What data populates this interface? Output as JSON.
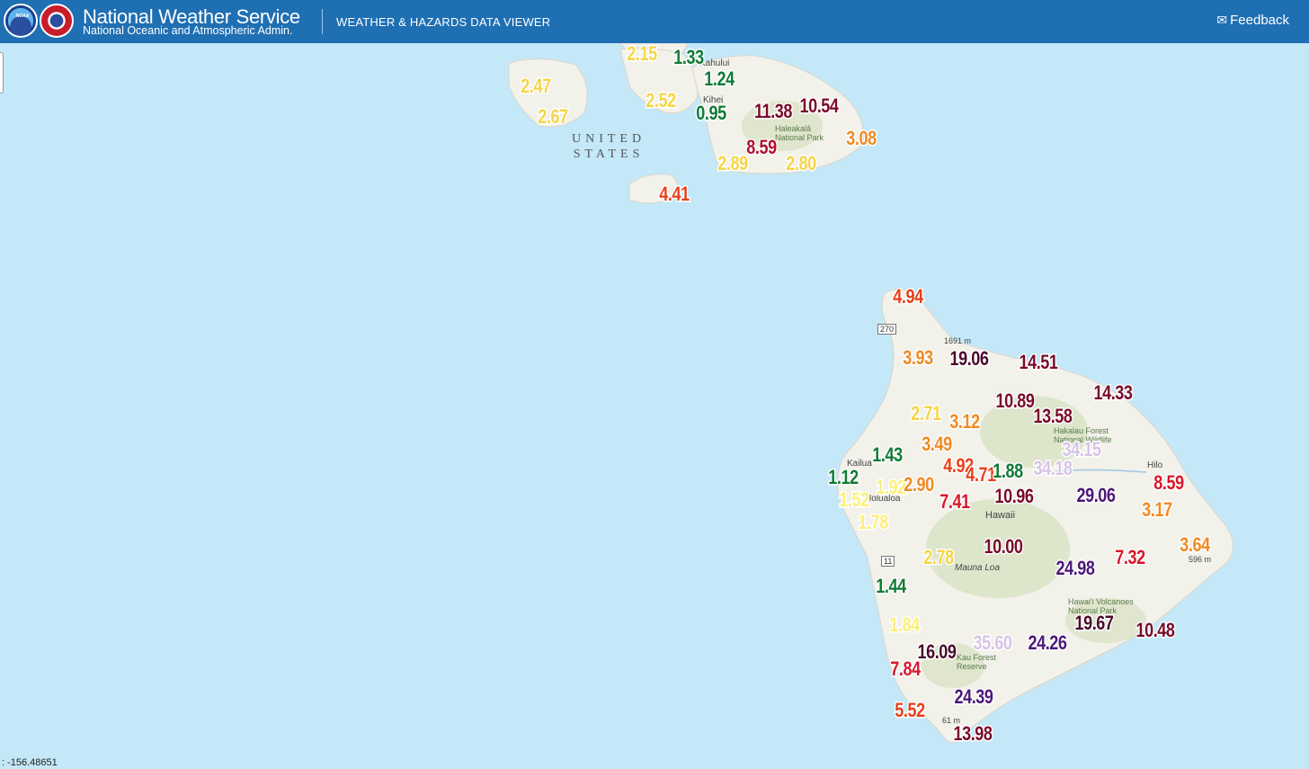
{
  "header": {
    "title": "National Weather Service",
    "subtitle": "National Oceanic and Atmospheric Admin.",
    "app_title": "WEATHER & HAZARDS DATA VIEWER",
    "feedback_label": "Feedback",
    "noaa_logo_text": "NOAA"
  },
  "map": {
    "country_label_1": "UNITED",
    "country_label_2": "STATES",
    "places": {
      "kahului": "Kahului",
      "kihei": "Kihei",
      "haleakala": "Haleakalā National Park",
      "hilo": "Hilo",
      "kailua": "Kailua",
      "holualoa": "Holualoa",
      "hawaii": "Hawaii",
      "mauna_loa": "Mauna Loa",
      "hakalau": "Hakalau Forest National Wildlife",
      "volcanoes": "Hawai'i Volcanoes National Park",
      "kau_forest": "Kau Forest Reserve",
      "elev_1691": "1691 m",
      "elev_596": "596 m",
      "elev_61": "61 m"
    },
    "shields": {
      "r270": "270",
      "r11": "11"
    },
    "coordinate_readout": ": -156.48651"
  },
  "colors": {
    "yellow": "#f5d547",
    "green": "#0f7a35",
    "orange": "#f08a24",
    "red_orange": "#e8401c",
    "red": "#d6182a",
    "crimson": "#b0102e",
    "maroon": "#7a0a2a",
    "dark_maroon": "#4a0a2a",
    "purple": "#4b1878",
    "lavender": "#d8c4e6",
    "pale_yellow": "#fbf07a",
    "ocean": "#c4e8f8",
    "land": "#f2f1ea",
    "header": "#1f6fb3"
  },
  "precip_values": [
    {
      "id": "m1",
      "text": "2.15",
      "color": "#f5d547"
    },
    {
      "id": "m2",
      "text": "1.33",
      "color": "#0f7a35"
    },
    {
      "id": "m3",
      "text": "1.24",
      "color": "#0f7a35"
    },
    {
      "id": "m4",
      "text": "2.47",
      "color": "#f5d547"
    },
    {
      "id": "m5",
      "text": "2.52",
      "color": "#f5d547"
    },
    {
      "id": "m6",
      "text": "0.95",
      "color": "#0f7a35"
    },
    {
      "id": "m7",
      "text": "11.38",
      "color": "#7a0a2a"
    },
    {
      "id": "m8",
      "text": "10.54",
      "color": "#7a0a2a"
    },
    {
      "id": "m9",
      "text": "2.67",
      "color": "#f5d547"
    },
    {
      "id": "m10",
      "text": "8.59",
      "color": "#b0102e"
    },
    {
      "id": "m11",
      "text": "3.08",
      "color": "#f08a24"
    },
    {
      "id": "m12",
      "text": "2.89",
      "color": "#f5d547"
    },
    {
      "id": "m13",
      "text": "2.80",
      "color": "#f5d547"
    },
    {
      "id": "m14",
      "text": "4.41",
      "color": "#e8401c"
    },
    {
      "id": "b1",
      "text": "4.94",
      "color": "#e8401c"
    },
    {
      "id": "b2",
      "text": "3.93",
      "color": "#f08a24"
    },
    {
      "id": "b3",
      "text": "19.06",
      "color": "#4a0a2a"
    },
    {
      "id": "b4",
      "text": "14.51",
      "color": "#7a0a2a"
    },
    {
      "id": "b5",
      "text": "14.33",
      "color": "#7a0a2a"
    },
    {
      "id": "b6",
      "text": "10.89",
      "color": "#7a0a2a"
    },
    {
      "id": "b7",
      "text": "2.71",
      "color": "#f5d547"
    },
    {
      "id": "b8",
      "text": "3.12",
      "color": "#f08a24"
    },
    {
      "id": "b9",
      "text": "13.58",
      "color": "#7a0a2a"
    },
    {
      "id": "b10",
      "text": "3.49",
      "color": "#f08a24"
    },
    {
      "id": "b11",
      "text": "34.15",
      "color": "#d8c4e6"
    },
    {
      "id": "b12",
      "text": "1.43",
      "color": "#0f7a35"
    },
    {
      "id": "b13",
      "text": "4.92",
      "color": "#e8401c"
    },
    {
      "id": "b14",
      "text": "4.71",
      "color": "#e8401c"
    },
    {
      "id": "b15",
      "text": "1.88",
      "color": "#0f7a35"
    },
    {
      "id": "b16",
      "text": "34.18",
      "color": "#d8c4e6"
    },
    {
      "id": "b17",
      "text": "1.12",
      "color": "#0f7a35"
    },
    {
      "id": "b18",
      "text": "1.92",
      "color": "#fbf07a"
    },
    {
      "id": "b19",
      "text": "2.90",
      "color": "#f08a24"
    },
    {
      "id": "b20",
      "text": "10.96",
      "color": "#7a0a2a"
    },
    {
      "id": "b21",
      "text": "29.06",
      "color": "#4b1878"
    },
    {
      "id": "b22",
      "text": "8.59",
      "color": "#d6182a"
    },
    {
      "id": "b23",
      "text": "1.52",
      "color": "#fbf07a"
    },
    {
      "id": "b24",
      "text": "7.41",
      "color": "#d6182a"
    },
    {
      "id": "b25",
      "text": "3.17",
      "color": "#f08a24"
    },
    {
      "id": "b26",
      "text": "1.78",
      "color": "#fbf07a"
    },
    {
      "id": "b27",
      "text": "10.00",
      "color": "#7a0a2a"
    },
    {
      "id": "b28",
      "text": "3.64",
      "color": "#f08a24"
    },
    {
      "id": "b29",
      "text": "2.78",
      "color": "#f5d547"
    },
    {
      "id": "b30",
      "text": "7.32",
      "color": "#d6182a"
    },
    {
      "id": "b31",
      "text": "24.98",
      "color": "#4b1878"
    },
    {
      "id": "b32",
      "text": "1.44",
      "color": "#0f7a35"
    },
    {
      "id": "b33",
      "text": "19.67",
      "color": "#4a0a2a"
    },
    {
      "id": "b34",
      "text": "1.84",
      "color": "#fbf07a"
    },
    {
      "id": "b35",
      "text": "10.48",
      "color": "#7a0a2a"
    },
    {
      "id": "b36",
      "text": "16.09",
      "color": "#4a0a2a"
    },
    {
      "id": "b37",
      "text": "35.60",
      "color": "#d8c4e6"
    },
    {
      "id": "b38",
      "text": "24.26",
      "color": "#4b1878"
    },
    {
      "id": "b39",
      "text": "7.84",
      "color": "#d6182a"
    },
    {
      "id": "b40",
      "text": "24.39",
      "color": "#4b1878"
    },
    {
      "id": "b41",
      "text": "5.52",
      "color": "#e8401c"
    },
    {
      "id": "b42",
      "text": "13.98",
      "color": "#7a0a2a"
    }
  ]
}
